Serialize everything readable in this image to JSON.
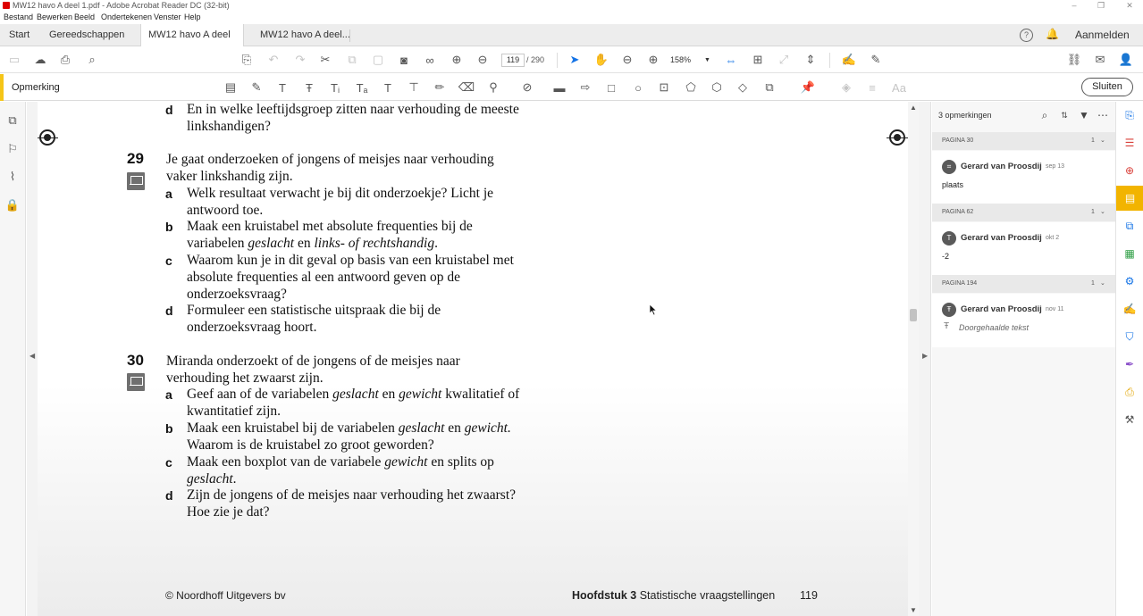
{
  "window": {
    "title": "MW12 havo A deel 1.pdf - Adobe Acrobat Reader DC (32-bit)",
    "controls": {
      "minimize": "‒",
      "restore": "❐",
      "close": "✕"
    }
  },
  "menu": [
    "Bestand",
    "Bewerken",
    "Beeld",
    "Ondertekenen",
    "Venster",
    "Help"
  ],
  "tabs": {
    "start": "Start",
    "tools": "Gereedschappen",
    "doc_active": "MW12 havo A deel ...",
    "doc_active_close": "×",
    "doc_other": "MW12 havo A deel...",
    "signin": "Aanmelden"
  },
  "toolbar": {
    "page_current": "119",
    "page_total": "/ 290",
    "zoom": "158%"
  },
  "comment_toolbar": {
    "label": "Opmerking",
    "close_button": "Sluiten",
    "font_label": "Aa"
  },
  "document": {
    "top_d_letter": "d",
    "top_d_lines": [
      "En in welke leeftijdsgroep zitten naar verhouding de meeste",
      "linkshandigen?"
    ],
    "q29": {
      "number": "29",
      "intro": [
        "Je gaat onderzoeken of jongens of meisjes naar verhouding",
        "vaker linkshandig zijn."
      ],
      "a_letter": "a",
      "a_lines": [
        "Welk resultaat verwacht je bij dit onderzoekje? Licht je",
        "antwoord toe."
      ],
      "b_letter": "b",
      "b_line1": "Maak een kruistabel met absolute frequenties bij de",
      "b_line2_pre": "variabelen ",
      "b_line2_it1": "geslacht",
      "b_line2_mid": " en ",
      "b_line2_it2": "links- of rechtshandig",
      "b_line2_end": ".",
      "c_letter": "c",
      "c_lines": [
        "Waarom kun je in dit geval op basis van een kruistabel met",
        "absolute frequenties al een antwoord geven op de",
        "onderzoeksvraag?"
      ],
      "d_letter": "d",
      "d_lines": [
        "Formuleer een statistische uitspraak die bij de",
        "onderzoeksvraag hoort."
      ]
    },
    "q30": {
      "number": "30",
      "intro": [
        "Miranda onderzoekt of de jongens of de meisjes naar",
        "verhouding het zwaarst zijn."
      ],
      "a_letter": "a",
      "a_line1_pre": "Geef aan of de variabelen ",
      "a_line1_it1": "geslacht",
      "a_line1_mid": " en ",
      "a_line1_it2": "gewicht",
      "a_line1_end": " kwalitatief of",
      "a_line2": "kwantitatief zijn.",
      "b_letter": "b",
      "b_line1_pre": "Maak een kruistabel bij de variabelen ",
      "b_line1_it1": "geslacht",
      "b_line1_mid": " en ",
      "b_line1_it2": "gewicht.",
      "b_line2": "Waarom is de kruistabel zo groot geworden?",
      "c_letter": "c",
      "c_line1_pre": "Maak een boxplot van de variabele ",
      "c_line1_it": "gewicht",
      "c_line1_end": " en splits op",
      "c_line2_it": "geslacht",
      "c_line2_end": ".",
      "d_letter": "d",
      "d_lines": [
        "Zijn de jongens of de meisjes naar verhouding het zwaarst?",
        "Hoe zie je dat?"
      ]
    },
    "footer_left": "© Noordhoff Uitgevers bv",
    "footer_chapter": "Hoofdstuk 3",
    "footer_title": "Statistische vraagstellingen",
    "footer_page": "119"
  },
  "comments_panel": {
    "count_label": "3 opmerkingen",
    "groups": [
      {
        "page": "PAGINA 30",
        "count": "1",
        "author": "Gerard van Proosdij",
        "date": "sep 13",
        "text": "plaats"
      },
      {
        "page": "PAGINA 62",
        "count": "1",
        "author": "Gerard van Proosdij",
        "date": "okt 2",
        "text": "-2"
      },
      {
        "page": "PAGINA 194",
        "count": "1",
        "author": "Gerard van Proosdij",
        "date": "nov 11",
        "text": "Doorgehaalde tekst"
      }
    ]
  },
  "colors": {
    "accent_yellow": "#f5c518",
    "acrobat_blue": "#1473e6",
    "panel_active": "#f2b400"
  }
}
